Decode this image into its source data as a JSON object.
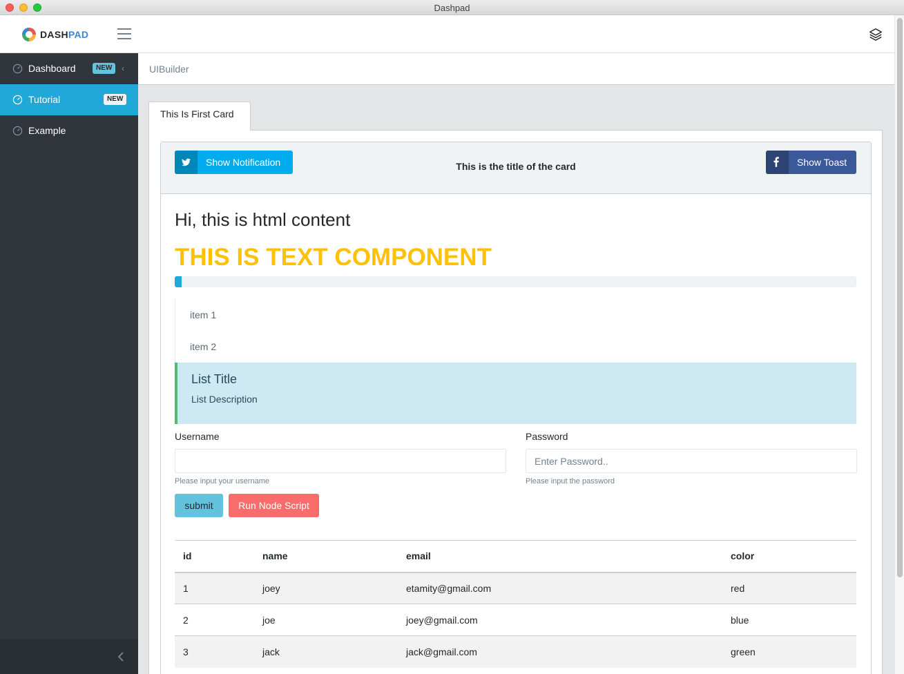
{
  "window": {
    "title": "Dashpad"
  },
  "brand": {
    "name_part1": "DASH",
    "name_part2": "PAD"
  },
  "sidebar": {
    "items": [
      {
        "label": "Dashboard",
        "badge": "NEW",
        "active": false
      },
      {
        "label": "Tutorial",
        "badge": "NEW",
        "active": true
      },
      {
        "label": "Example",
        "badge": "",
        "active": false
      }
    ]
  },
  "breadcrumb": {
    "current": "UIBuilder"
  },
  "tabs": [
    {
      "label": "This Is First Card"
    }
  ],
  "card": {
    "title": "This is the title of the card",
    "notify_button": "Show Notification",
    "toast_button": "Show Toast"
  },
  "content": {
    "html_text": "Hi, this is html content",
    "text_component": "THIS IS TEXT COMPONENT",
    "progress_fraction": 0.01
  },
  "list": {
    "items": [
      "item 1",
      "item 2"
    ],
    "active_title": "List Title",
    "active_description": "List Description"
  },
  "form": {
    "username": {
      "label": "Username",
      "value": "",
      "placeholder": "",
      "help": "Please input your username"
    },
    "password": {
      "label": "Password",
      "value": "",
      "placeholder": "Enter Password..",
      "help": "Please input the password"
    },
    "submit_label": "submit",
    "run_label": "Run Node Script"
  },
  "table": {
    "columns": [
      "id",
      "name",
      "email",
      "color"
    ],
    "rows": [
      [
        "1",
        "joey",
        "etamity@gmail.com",
        "red"
      ],
      [
        "2",
        "joe",
        "joey@gmail.com",
        "blue"
      ],
      [
        "3",
        "jack",
        "jack@gmail.com",
        "green"
      ]
    ]
  },
  "colors": {
    "primary": "#20a8d8",
    "sidebar": "#2f353a",
    "warning_text": "#ffc107",
    "info": "#63c2de",
    "danger": "#f86c6b",
    "twitter": "#00aced",
    "facebook": "#3b5998",
    "success_border": "#4dbd74"
  }
}
